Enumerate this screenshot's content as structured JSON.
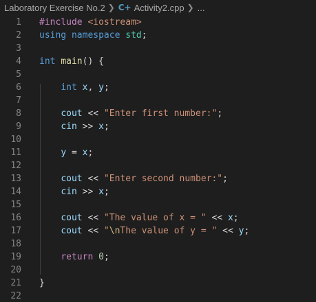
{
  "breadcrumb": {
    "folder": "Laboratory Exercise No.2",
    "file": "Activity2.cpp",
    "trail": "...",
    "file_icon": "cpp-file-icon",
    "separator_icon": "chevron-right-icon"
  },
  "lines": [
    {
      "n": "1",
      "tokens": [
        {
          "t": "#include ",
          "c": "pre"
        },
        {
          "t": "<iostream>",
          "c": "str"
        }
      ]
    },
    {
      "n": "2",
      "tokens": [
        {
          "t": "using",
          "c": "kw"
        },
        {
          "t": " ",
          "c": "op"
        },
        {
          "t": "namespace",
          "c": "kw"
        },
        {
          "t": " ",
          "c": "op"
        },
        {
          "t": "std",
          "c": "ns"
        },
        {
          "t": ";",
          "c": "op"
        }
      ]
    },
    {
      "n": "3",
      "tokens": []
    },
    {
      "n": "4",
      "tokens": [
        {
          "t": "int",
          "c": "kw"
        },
        {
          "t": " ",
          "c": "op"
        },
        {
          "t": "main",
          "c": "fn"
        },
        {
          "t": "() {",
          "c": "op"
        }
      ]
    },
    {
      "n": "5",
      "tokens": []
    },
    {
      "n": "6",
      "tokens": [
        {
          "t": "    ",
          "c": "op"
        },
        {
          "t": "int",
          "c": "kw"
        },
        {
          "t": " ",
          "c": "op"
        },
        {
          "t": "x",
          "c": "var"
        },
        {
          "t": ", ",
          "c": "op"
        },
        {
          "t": "y",
          "c": "var"
        },
        {
          "t": ";",
          "c": "op"
        }
      ]
    },
    {
      "n": "7",
      "tokens": []
    },
    {
      "n": "8",
      "tokens": [
        {
          "t": "    ",
          "c": "op"
        },
        {
          "t": "cout",
          "c": "var"
        },
        {
          "t": " << ",
          "c": "op"
        },
        {
          "t": "\"Enter first number:\"",
          "c": "str"
        },
        {
          "t": ";",
          "c": "op"
        }
      ]
    },
    {
      "n": "9",
      "tokens": [
        {
          "t": "    ",
          "c": "op"
        },
        {
          "t": "cin",
          "c": "var"
        },
        {
          "t": " >> ",
          "c": "op"
        },
        {
          "t": "x",
          "c": "var"
        },
        {
          "t": ";",
          "c": "op"
        }
      ]
    },
    {
      "n": "10",
      "tokens": []
    },
    {
      "n": "11",
      "tokens": [
        {
          "t": "    ",
          "c": "op"
        },
        {
          "t": "y",
          "c": "var"
        },
        {
          "t": " = ",
          "c": "op"
        },
        {
          "t": "x",
          "c": "var"
        },
        {
          "t": ";",
          "c": "op"
        }
      ]
    },
    {
      "n": "12",
      "tokens": []
    },
    {
      "n": "13",
      "tokens": [
        {
          "t": "    ",
          "c": "op"
        },
        {
          "t": "cout",
          "c": "var"
        },
        {
          "t": " << ",
          "c": "op"
        },
        {
          "t": "\"Enter second number:\"",
          "c": "str"
        },
        {
          "t": ";",
          "c": "op"
        }
      ]
    },
    {
      "n": "14",
      "tokens": [
        {
          "t": "    ",
          "c": "op"
        },
        {
          "t": "cin",
          "c": "var"
        },
        {
          "t": " >> ",
          "c": "op"
        },
        {
          "t": "x",
          "c": "var"
        },
        {
          "t": ";",
          "c": "op"
        }
      ]
    },
    {
      "n": "15",
      "tokens": []
    },
    {
      "n": "16",
      "tokens": [
        {
          "t": "    ",
          "c": "op"
        },
        {
          "t": "cout",
          "c": "var"
        },
        {
          "t": " << ",
          "c": "op"
        },
        {
          "t": "\"The value of x = \"",
          "c": "str"
        },
        {
          "t": " << ",
          "c": "op"
        },
        {
          "t": "x",
          "c": "var"
        },
        {
          "t": ";",
          "c": "op"
        }
      ]
    },
    {
      "n": "17",
      "tokens": [
        {
          "t": "    ",
          "c": "op"
        },
        {
          "t": "cout",
          "c": "var"
        },
        {
          "t": " << ",
          "c": "op"
        },
        {
          "t": "\"",
          "c": "str"
        },
        {
          "t": "\\n",
          "c": "esc"
        },
        {
          "t": "The value of y = \"",
          "c": "str"
        },
        {
          "t": " << ",
          "c": "op"
        },
        {
          "t": "y",
          "c": "var"
        },
        {
          "t": ";",
          "c": "op"
        }
      ]
    },
    {
      "n": "18",
      "tokens": []
    },
    {
      "n": "19",
      "tokens": [
        {
          "t": "    ",
          "c": "op"
        },
        {
          "t": "return",
          "c": "ctl"
        },
        {
          "t": " ",
          "c": "op"
        },
        {
          "t": "0",
          "c": "num"
        },
        {
          "t": ";",
          "c": "op"
        }
      ]
    },
    {
      "n": "20",
      "tokens": []
    },
    {
      "n": "21",
      "tokens": [
        {
          "t": "}",
          "c": "op"
        }
      ]
    },
    {
      "n": "22",
      "tokens": []
    }
  ],
  "colors": {
    "background": "#1e1e1e",
    "line_number": "#858585",
    "keyword": "#569cd6",
    "string": "#ce9178",
    "preprocessor": "#c586c0",
    "function": "#dcdcaa",
    "variable": "#9cdcfe",
    "number": "#b5cea8",
    "namespace": "#4ec9b0"
  }
}
